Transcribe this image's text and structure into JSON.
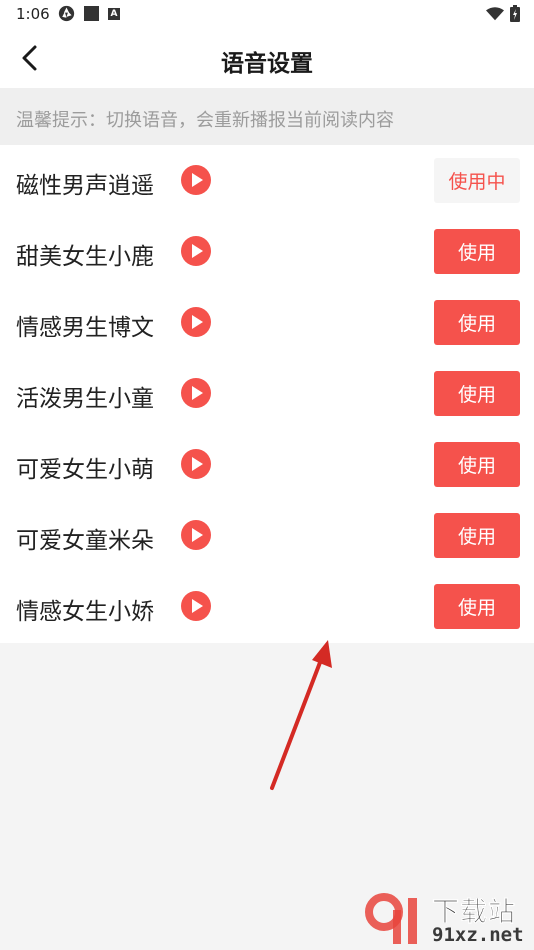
{
  "status_bar": {
    "time": "1:06",
    "icons": [
      "aperture-icon",
      "square-icon",
      "a-icon",
      "wifi-icon",
      "battery-icon"
    ]
  },
  "header": {
    "title": "语音设置",
    "back_icon": "chevron-left-icon"
  },
  "tip": {
    "text": "温馨提示：切换语音，会重新播报当前阅读内容"
  },
  "voices": [
    {
      "name": "磁性男声逍遥",
      "button_label": "使用中",
      "active": true
    },
    {
      "name": "甜美女生小鹿",
      "button_label": "使用",
      "active": false
    },
    {
      "name": "情感男生博文",
      "button_label": "使用",
      "active": false
    },
    {
      "name": "活泼男生小童",
      "button_label": "使用",
      "active": false
    },
    {
      "name": "可爱女生小萌",
      "button_label": "使用",
      "active": false
    },
    {
      "name": "可爱女童米朵",
      "button_label": "使用",
      "active": false
    },
    {
      "name": "情感女生小娇",
      "button_label": "使用",
      "active": false
    }
  ],
  "watermark": {
    "brand": "下载站",
    "domain": "91xz.net"
  },
  "colors": {
    "accent": "#f5524c",
    "active_button_bg": "#f5f5f5",
    "page_bg": "#f4f4f4",
    "tip_text": "#9c9c9c",
    "arrow": "#d42a24"
  }
}
